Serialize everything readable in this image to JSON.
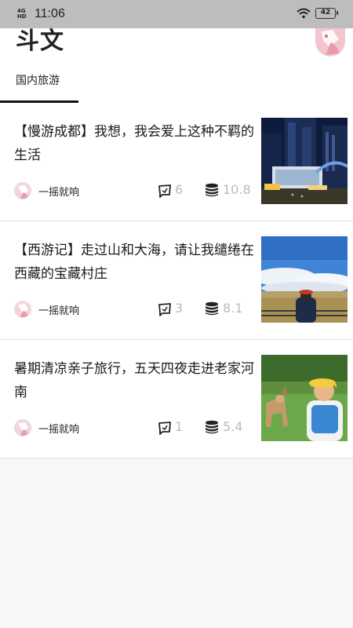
{
  "status_bar": {
    "network": "4G HD",
    "time": "11:06",
    "battery": "42"
  },
  "header": {
    "title": "斗文",
    "tab": "国内旅游"
  },
  "articles": [
    {
      "title": "【慢游成都】我想，我会爱上这种不羁的生活",
      "author": "一摇就响",
      "comments": "6",
      "coins": "10.8"
    },
    {
      "title": "【西游记】走过山和大海，请让我缱绻在西藏的宝藏村庄",
      "author": "一摇就响",
      "comments": "3",
      "coins": "8.1"
    },
    {
      "title": "暑期清凉亲子旅行，五天四夜走进老家河南",
      "author": "一摇就响",
      "comments": "1",
      "coins": "5.4"
    }
  ],
  "colors": {
    "statusbar": "#bdbdbd",
    "background": "#f7f7f7",
    "tab_indicator": "#111111",
    "meta_text": "#bbbbbb"
  }
}
